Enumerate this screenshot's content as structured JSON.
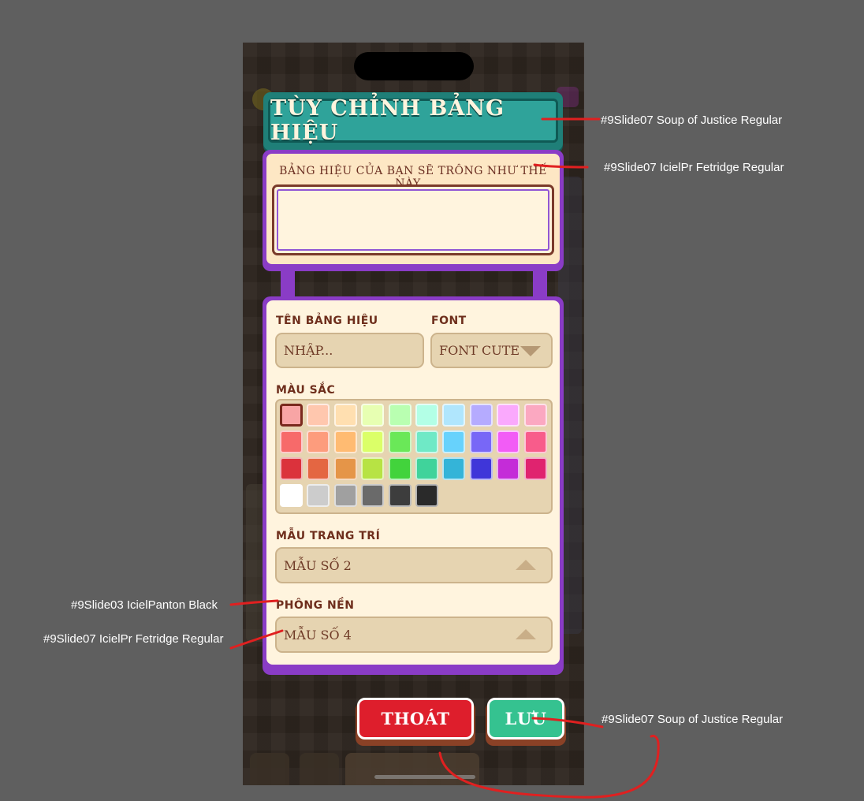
{
  "dialog": {
    "title": "TÙY CHỈNH BẢNG HIỆU",
    "preview_caption": "BẢNG HIỆU CỦA BẠN SẼ TRÔNG NHƯ THẾ NÀY...",
    "preview_text": ""
  },
  "form": {
    "name_label": "TÊN BẢNG HIỆU",
    "name_placeholder": "NHẬP...",
    "font_label": "FONT",
    "font_value": "FONT CUTE",
    "color_label": "MÀU SẮC",
    "decor_label": "MẪU TRANG TRÍ",
    "decor_value": "MẪU SỐ 2",
    "background_label": "PHÔNG NỀN",
    "background_value": "MẪU SỐ 4"
  },
  "palette": {
    "selected_index": 0,
    "colors": [
      "#f8a5a5",
      "#ffc7ae",
      "#ffdfb0",
      "#e7ffb2",
      "#b9ffb1",
      "#b3ffe6",
      "#b0e6fd",
      "#b5abff",
      "#faa9fd",
      "#fba8c1",
      "#f76a6a",
      "#fd9c7d",
      "#ffbb72",
      "#dbff68",
      "#6ae858",
      "#6fe9c6",
      "#67d2fc",
      "#7867f7",
      "#f25cf6",
      "#f85c8b",
      "#db323c",
      "#e46642",
      "#e59548",
      "#b7e344",
      "#42d33c",
      "#40d39b",
      "#34b4d8",
      "#3f36d9",
      "#c42cd8",
      "#e0236f",
      "#ffffff",
      "#cccccc",
      "#a0a0a0",
      "#6a6a6a",
      "#3d3d3d",
      "#2a2a2a"
    ]
  },
  "buttons": {
    "exit_label": "THOÁT",
    "save_label": "LƯU",
    "exit_color": "#de1e2c",
    "save_color": "#35c290"
  },
  "annotations": {
    "title_font": "#9Slide07 Soup of Justice Regular",
    "caption_font": "#9Slide07 IcielPr Fetridge Regular",
    "label_font": "#9Slide03 IcielPanton Black",
    "value_font": "#9Slide07 IcielPr Fetridge Regular",
    "button_font": "#9Slide07 Soup of Justice Regular"
  }
}
